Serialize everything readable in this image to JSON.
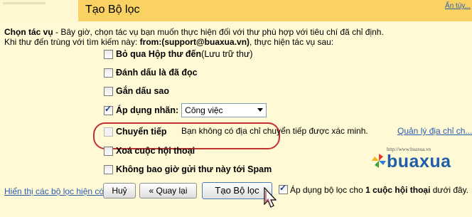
{
  "header": {
    "title": "Tạo Bộ lọc",
    "hide_link": "Ẩn tùy..."
  },
  "instructions": {
    "heading": "Chọn tác vụ",
    "line1_rest": " - Bây giờ, chọn tác vụ bạn muốn thực hiện đối với thư phù hợp với tiêu chí đã chỉ định.",
    "line2_prefix": "Khi thư đến trùng với tìm kiếm này: ",
    "search_query": "from:(support@buaxua.vn)",
    "line2_suffix": ", thực hiện tác vụ sau:"
  },
  "options": {
    "skip_inbox": {
      "label": "Bỏ qua Hộp thư đến",
      "note": " (Lưu trữ thư)",
      "checked": false
    },
    "mark_read": {
      "label": "Đánh dấu là đã đọc",
      "checked": false
    },
    "star": {
      "label": "Gắn dấu sao",
      "checked": false
    },
    "apply_label": {
      "label": "Áp dụng nhãn:",
      "checked": true,
      "selected": "Công việc"
    },
    "forward": {
      "label": "Chuyển tiếp",
      "checked": false,
      "disabled": true,
      "message": "Bạn không có địa chỉ chuyển tiếp được xác minh.",
      "manage_link": "Quản lý địa chỉ ch..."
    },
    "delete": {
      "label": "Xoá cuộc hội thoại",
      "checked": false
    },
    "never_spam": {
      "label": "Không bao giờ gửi thư này tới Spam",
      "checked": false
    }
  },
  "logo": {
    "url": "http://www.buaxua.vn",
    "text": "buaxua"
  },
  "footer": {
    "show_filters_link": "Hiển thị các bộ lọc hiện có",
    "cancel": "Huỷ",
    "back": "« Quay lại",
    "create": "Tạo Bộ lọc",
    "apply_prefix": "Áp dụng bộ lọc cho ",
    "apply_bold": "1 cuộc hội thoại",
    "apply_suffix": " dưới đây.",
    "apply_checked": true
  }
}
